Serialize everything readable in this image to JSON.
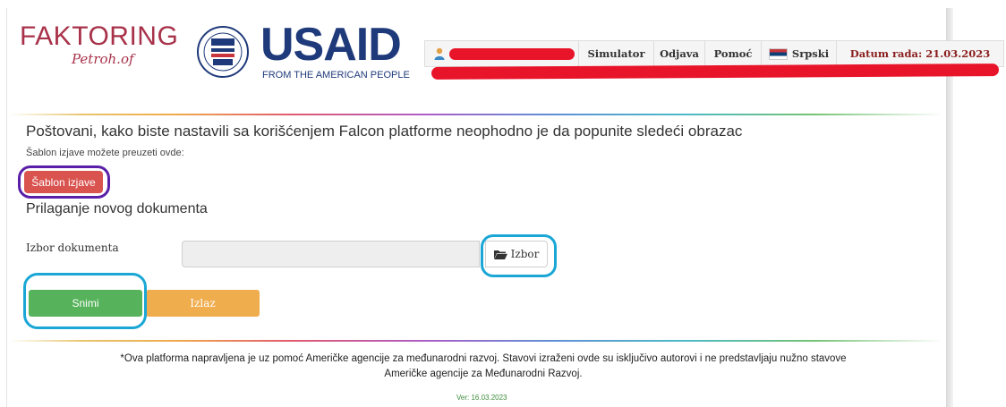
{
  "header": {
    "faktoring_logo": "FAKTORING",
    "faktoring_sub": "Petroh.of",
    "usaid_logo": "USAID",
    "usaid_tagline": "FROM THE AMERICAN PEOPLE",
    "usaid_seal_text": "USAID"
  },
  "topbar": {
    "items": [
      {
        "label": "Simulator"
      },
      {
        "label": "Odjava"
      },
      {
        "label": "Pomoć"
      },
      {
        "label": "Srpski"
      }
    ],
    "date_label": "Datum rada: 21.03.2023"
  },
  "main": {
    "title": "Poštovani, kako biste nastavili sa korišćenjem Falcon platforme neophodno je da popunite sledeći obrazac",
    "template_note": "Šablon izjave možete preuzeti ovde:",
    "template_button": "Šablon izjave",
    "section_title": "Prilaganje novog dokumenta",
    "document_label": "Izbor dokumenta",
    "document_value": "",
    "browse_button": "Izbor",
    "save_button": "Snimi",
    "exit_button": "Izlaz"
  },
  "footer": {
    "disclaimer": "*Ova platforma napravljena je uz pomoć Američke agencije za međunarodni razvoj. Stavovi izraženi ovde su isključivo autorovi i ne predstavljaju nužno stavove Američke agencije za Međunarodni Razvoj.",
    "version": "Ver: 16.03.2023"
  },
  "colors": {
    "brand_red": "#a8324a",
    "usaid_blue": "#1f3a7a",
    "danger": "#d9534f",
    "success": "#57b35b",
    "warning": "#f0ad4e",
    "annotation_purple": "#5a1fa8",
    "annotation_blue": "#1aa7d6",
    "redaction": "#e8142a"
  }
}
